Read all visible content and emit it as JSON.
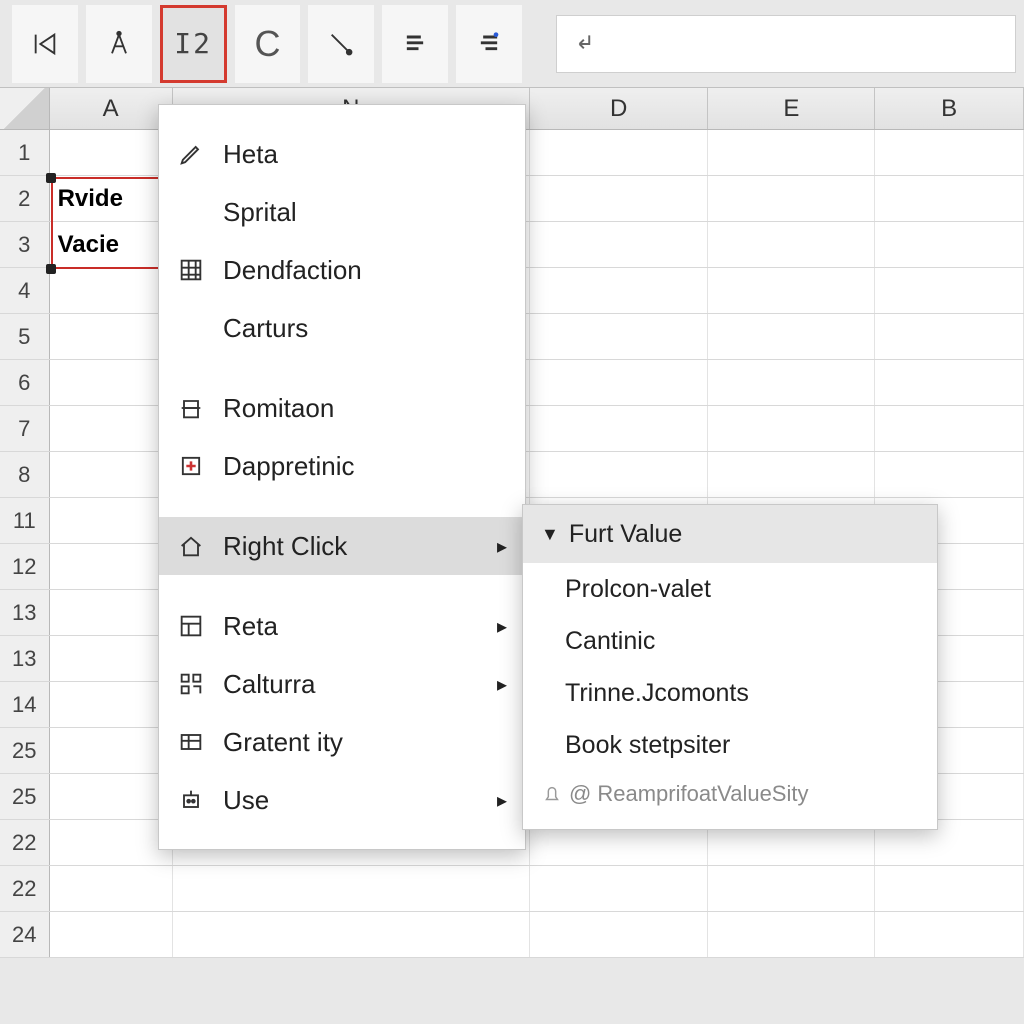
{
  "toolbar": {
    "highlight_label": "I2"
  },
  "columns": [
    "A",
    "N",
    "D",
    "E",
    "B"
  ],
  "row_numbers": [
    1,
    2,
    3,
    4,
    5,
    6,
    7,
    8,
    11,
    12,
    13,
    13,
    14,
    25,
    25,
    22,
    22,
    24
  ],
  "cells": {
    "A2": "Rvide",
    "A3": "Vacie"
  },
  "context_menu": {
    "group1": [
      {
        "label": "Heta",
        "icon": "pencil"
      },
      {
        "label": "Sprital",
        "icon": ""
      },
      {
        "label": "Dendfaction",
        "icon": "grid"
      },
      {
        "label": "Carturs",
        "icon": ""
      }
    ],
    "group2": [
      {
        "label": "Romitaon",
        "icon": "printer"
      },
      {
        "label": "Dappretinic",
        "icon": "medical"
      }
    ],
    "highlight": {
      "label": "Right Click",
      "icon": "home",
      "arrow": true
    },
    "group3": [
      {
        "label": "Reta",
        "icon": "layout",
        "arrow": true
      },
      {
        "label": "Calturra",
        "icon": "qr",
        "arrow": true
      },
      {
        "label": "Gratent ity",
        "icon": "table",
        "arrow": false
      },
      {
        "label": "Use",
        "icon": "robot",
        "arrow": true
      }
    ]
  },
  "submenu": {
    "header": "Furt Value",
    "items": [
      "Prolcon-valet",
      "Cantinic",
      "Trinne.Jcomonts",
      "Book stetpsiter"
    ],
    "footer_label": "ReamprifoatValueSity"
  }
}
